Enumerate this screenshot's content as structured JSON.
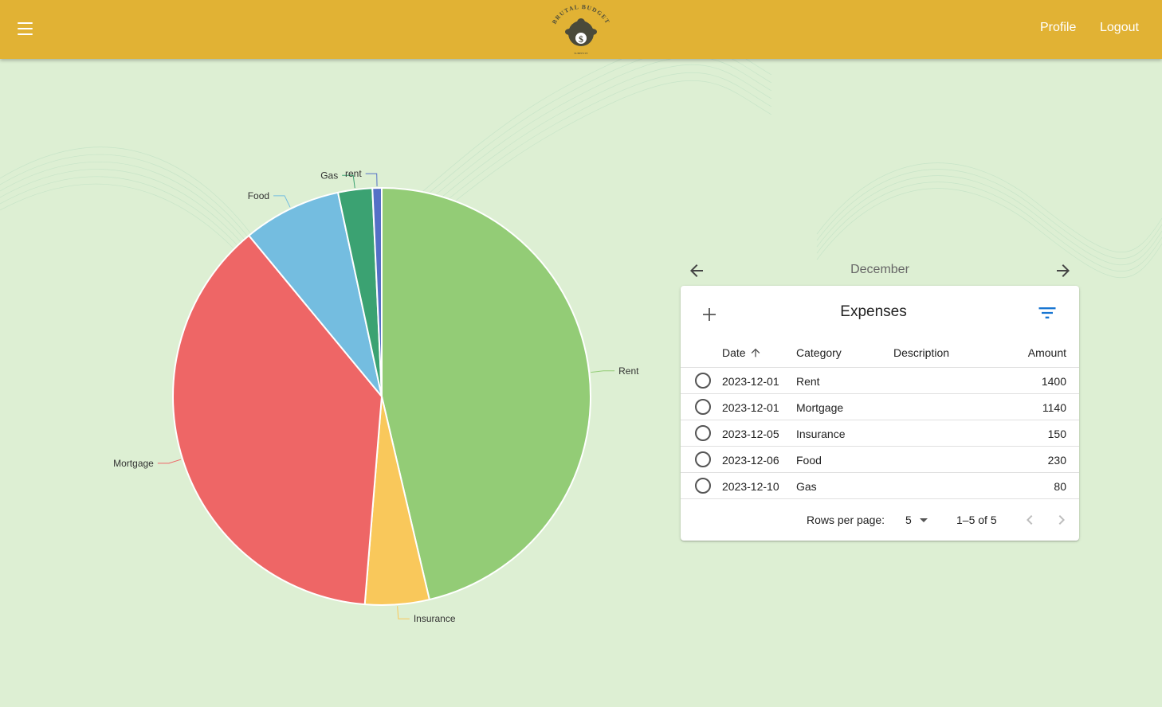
{
  "header": {
    "logo_text": "BRUTAL BUDGET",
    "logo_subtext": "SUBEESTE",
    "profile_label": "Profile",
    "logout_label": "Logout"
  },
  "month_nav": {
    "label": "December"
  },
  "expenses": {
    "title": "Expenses",
    "columns": {
      "date": "Date",
      "category": "Category",
      "description": "Description",
      "amount": "Amount"
    },
    "rows": [
      {
        "date": "2023-12-01",
        "category": "Rent",
        "description": "",
        "amount": "1400"
      },
      {
        "date": "2023-12-01",
        "category": "Mortgage",
        "description": "",
        "amount": "1140"
      },
      {
        "date": "2023-12-05",
        "category": "Insurance",
        "description": "",
        "amount": "150"
      },
      {
        "date": "2023-12-06",
        "category": "Food",
        "description": "",
        "amount": "230"
      },
      {
        "date": "2023-12-10",
        "category": "Gas",
        "description": "",
        "amount": "80"
      }
    ],
    "pagination": {
      "rows_per_page_label": "Rows per page:",
      "rows_per_page": "5",
      "range": "1–5 of 5"
    }
  },
  "chart_data": {
    "type": "pie",
    "labels": [
      "Rent",
      "Insurance",
      "Mortgage",
      "Food",
      "Gas",
      "rent"
    ],
    "values": [
      1400,
      150,
      1140,
      230,
      80,
      0.01
    ],
    "colors": [
      "#93cc76",
      "#f9c85b",
      "#ee6666",
      "#74bde0",
      "#3ba272",
      "#5470c6"
    ]
  }
}
